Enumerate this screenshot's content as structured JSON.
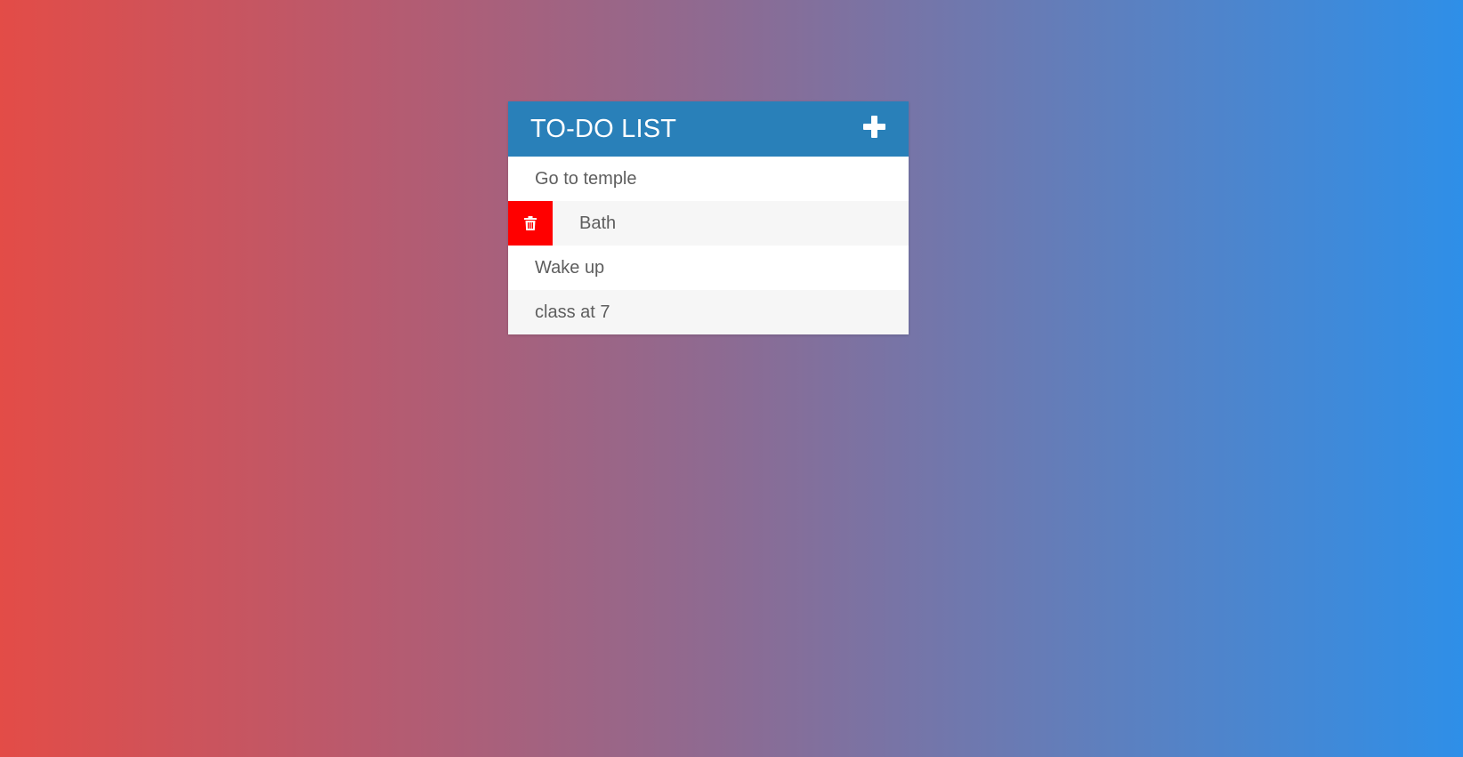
{
  "header": {
    "title": "TO-DO LIST",
    "add_icon": "plus-icon"
  },
  "todos": [
    {
      "label": "Go to temple",
      "show_delete": false
    },
    {
      "label": "Bath",
      "show_delete": true
    },
    {
      "label": "Wake up",
      "show_delete": false
    },
    {
      "label": "class at 7",
      "show_delete": false
    }
  ],
  "colors": {
    "header_bg": "#2980b9",
    "delete_bg": "#ff0000",
    "gradient_start": "#e34c47",
    "gradient_end": "#2e8fe8",
    "item_text": "#5e5e5e"
  },
  "delete_icon": "trash-icon"
}
